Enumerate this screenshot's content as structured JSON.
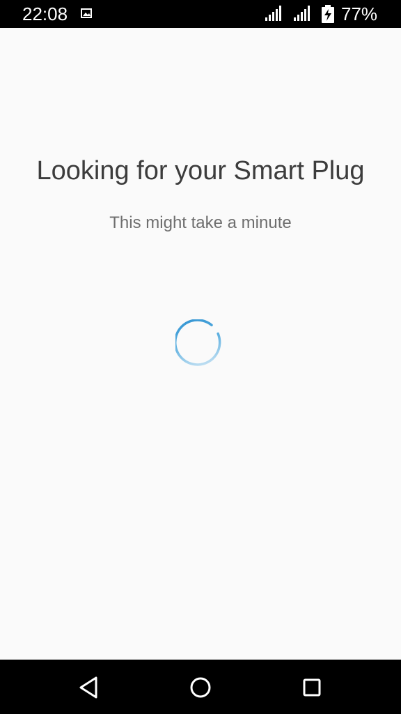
{
  "status_bar": {
    "time": "22:08",
    "battery_percent": "77%",
    "icons": [
      "gallery-notification-icon",
      "signal-icon",
      "signal-icon",
      "battery-charging-icon"
    ]
  },
  "main": {
    "title": "Looking for your Smart Plug",
    "subtitle": "This might take a minute",
    "loading_indicator": "progress-spinner-icon"
  },
  "nav_bar": {
    "buttons": [
      "back-icon",
      "home-icon",
      "recents-icon"
    ]
  },
  "colors": {
    "background": "#fafafa",
    "spinner_accent": "#2a8fd0",
    "bars": "#000000",
    "title_text": "#3c3c3c",
    "subtitle_text": "#6e6e6e"
  }
}
